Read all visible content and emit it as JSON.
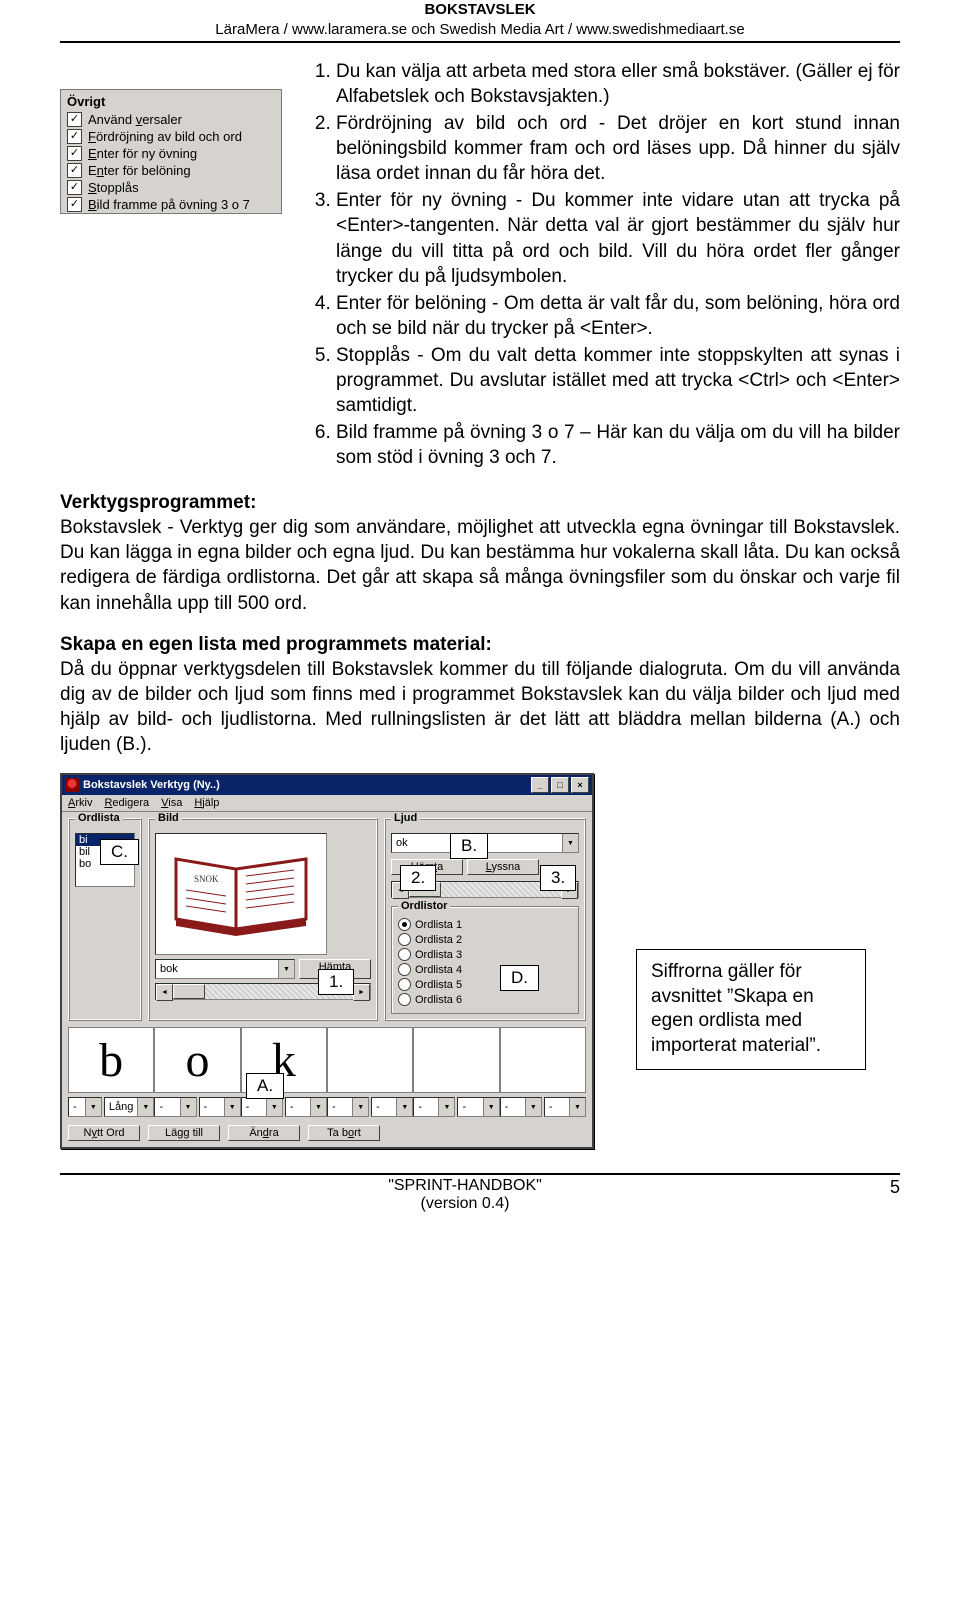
{
  "header": {
    "title": "BOKSTAVSLEK",
    "subtitle": "LäraMera / www.laramera.se  och Swedish Media Art / www.swedishmediaart.se"
  },
  "sidepanel": {
    "group_title": "Övrigt",
    "items": [
      "Använd <u>v</u>ersaler",
      "<u>F</u>ördröjning av bild och ord",
      "<u>E</u>nter för ny övning",
      "E<u>n</u>ter för belöning",
      "<u>S</u>topplås",
      "<u>B</u>ild framme på övning 3 o 7"
    ]
  },
  "list_items": [
    "Du kan välja att arbeta med stora eller små bokstäver. (Gäller ej för Alfabetslek och Bokstavsjakten.)",
    "Fördröjning av bild och ord - Det dröjer en kort stund innan belöningsbild kommer fram och ord läses upp. Då hinner du själv läsa ordet innan du får höra det.",
    "Enter för ny övning - Du kommer inte vidare utan att trycka på <Enter>-tangenten. När detta val är gjort bestämmer du själv hur länge du vill titta på ord och bild. Vill du höra ordet fler gånger trycker du på ljudsymbolen.",
    "Enter för belöning - Om detta är valt får du, som belöning, höra ord och se bild när du trycker på <Enter>.",
    "Stopplås - Om du valt detta kommer inte stoppskylten att synas i programmet. Du avslutar istället med att trycka <Ctrl> och <Enter> samtidigt.",
    "Bild framme på övning 3 o 7 – Här kan du välja om du vill ha bilder som stöd i övning 3 och 7."
  ],
  "section1": {
    "heading": "Verktygsprogrammet:",
    "text": "Bokstavslek - Verktyg ger dig som användare, möjlighet att utveckla egna övningar till Bokstavslek. Du kan lägga in egna bilder och egna ljud. Du kan bestämma hur vokalerna skall låta. Du kan också redigera de färdiga ordlistorna. Det går att skapa så många övningsfiler som du önskar och varje fil kan innehålla upp till 500 ord."
  },
  "section2": {
    "heading": "Skapa en egen lista med programmets material:",
    "text": "Då du öppnar verktygsdelen till Bokstavslek kommer du till följande dialogruta. Om du vill använda dig av de bilder och ljud som finns med i programmet Bokstavslek kan du välja bilder och ljud med hjälp av bild- och ljudlistorna. Med rullningslisten är det lätt att bläddra mellan bilderna (A.) och ljuden (B.)."
  },
  "tool": {
    "title": "Bokstavslek Verktyg (Ny..)",
    "menu": [
      "<u>A</u>rkiv",
      "<u>R</u>edigera",
      "<u>V</u>isa",
      "<u>H</u>jälp"
    ],
    "grp_ord": "Ordlista",
    "ord_items": [
      "bi",
      "bil",
      "bo"
    ],
    "grp_bild": "Bild",
    "bild_value": "bok",
    "bild_btn": "<u>H</u>ämta",
    "grp_ljud": "Ljud",
    "ljud_value": "ok",
    "ljud_btn1": "Häm<u>t</u>a",
    "ljud_btn2": "<u>L</u>yssna",
    "grp_ordlistor": "Ordlistor",
    "ordlistor": [
      "Ordlista <u>1</u>",
      "Ordlista <u>2</u>",
      "Ordlista <u>3</u>",
      "Ordlista <u>4</u>",
      "Ordlista <u>5</u>",
      "Ordlista <u>6</u>"
    ],
    "letters": [
      "b",
      "o",
      "k",
      "",
      "",
      ""
    ],
    "sound_first": "-",
    "sound_dur": "Lång",
    "btns": [
      "N<u>y</u>tt Ord",
      "Lä<u>g</u>g till",
      "Än<u>d</u>ra",
      "Ta b<u>o</u>rt"
    ]
  },
  "callouts": {
    "c": "C.",
    "b": "B.",
    "n2": "2.",
    "n3": "3.",
    "n1": "1.",
    "d": "D.",
    "a": "A."
  },
  "note": "Siffrorna gäller för avsnittet ”Skapa en egen ordlista med importerat material”.",
  "footer": {
    "center1": "\"SPRINT-HANDBOK\"",
    "center2": "(version 0.4)",
    "page": "5"
  }
}
